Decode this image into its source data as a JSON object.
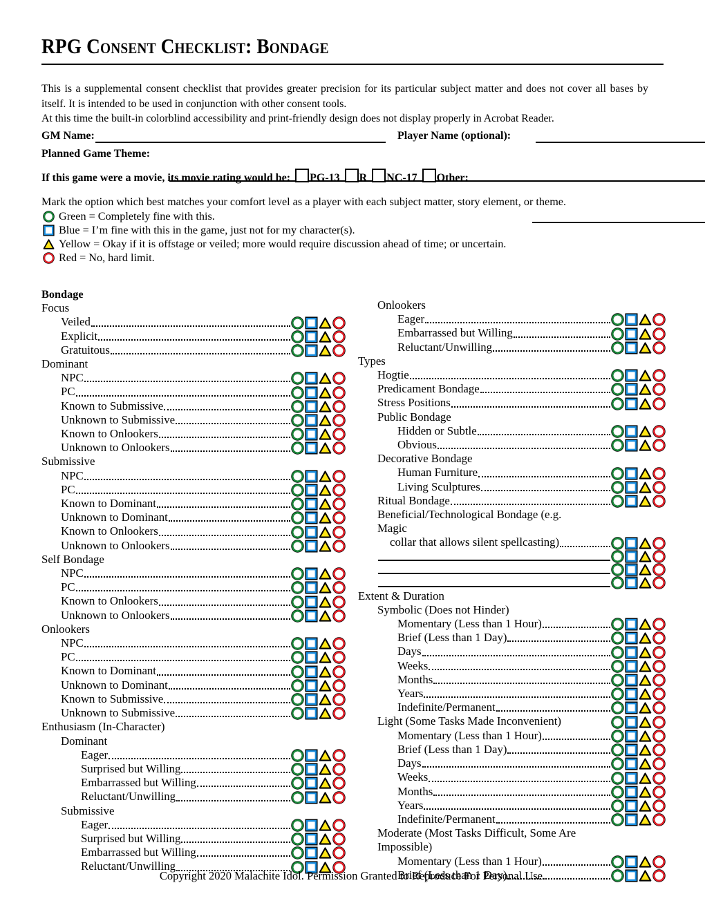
{
  "document": {
    "title": "RPG Consent Checklist: Bondage",
    "intro_line1": "This is a supplemental consent checklist that provides greater precision for its particular subject matter and does not cover all bases by itself. It is intended to be used in conjunction with other consent tools.",
    "intro_line2": "At this time the built-in colorblind accessibility and print-friendly design does not display properly in Acrobat Reader.",
    "footer": "Copyright 2020 Malachite Idol. Permission Granted to Reproduce For Personal Use."
  },
  "form": {
    "gm_name_label": "GM Name:",
    "gm_name_value": "",
    "player_name_label": "Player Name (optional):",
    "player_name_value": "",
    "theme_label": "Planned Game Theme:",
    "theme_value": "",
    "rating_label": "If this game were a movie, its movie rating would be:",
    "ratings": [
      "PG-13",
      "R",
      "NC-17"
    ],
    "other_label": "Other:",
    "other_value": ""
  },
  "legend": {
    "instruction": "Mark the option which best matches your comfort level as a player with each subject matter, story element, or theme.",
    "entries": [
      {
        "icon": "green-circle-icon",
        "text": "Green = Completely fine with this."
      },
      {
        "icon": "blue-square-icon",
        "text": "Blue = I’m fine with this in the game, just not for my character(s)."
      },
      {
        "icon": "yellow-triangle-icon",
        "text": "Yellow = Okay if it is offstage or veiled; more would require discussion ahead of time; or uncertain."
      },
      {
        "icon": "red-circle-icon",
        "text": "Red = No, hard limit."
      }
    ]
  },
  "colors": {
    "green": "#1a8a3a",
    "blue": "#1b8fe0",
    "yellow": "#ffe515",
    "red": "#e8212a",
    "outline": "#000000"
  },
  "section": {
    "name": "Bondage"
  },
  "left_column": [
    {
      "type": "group",
      "label": "Focus",
      "indent": 1
    },
    {
      "type": "item",
      "label": "Veiled",
      "indent": 2
    },
    {
      "type": "item",
      "label": "Explicit",
      "indent": 2
    },
    {
      "type": "item",
      "label": "Gratuitous",
      "indent": 2
    },
    {
      "type": "group",
      "label": "Dominant",
      "indent": 1
    },
    {
      "type": "item",
      "label": "NPC",
      "indent": 2
    },
    {
      "type": "item",
      "label": "PC",
      "indent": 2
    },
    {
      "type": "item",
      "label": "Known to Submissive",
      "indent": 2
    },
    {
      "type": "item",
      "label": "Unknown to Submissive",
      "indent": 2
    },
    {
      "type": "item",
      "label": "Known to Onlookers",
      "indent": 2
    },
    {
      "type": "item",
      "label": "Unknown to Onlookers",
      "indent": 2
    },
    {
      "type": "group",
      "label": "Submissive",
      "indent": 1
    },
    {
      "type": "item",
      "label": "NPC",
      "indent": 2
    },
    {
      "type": "item",
      "label": "PC",
      "indent": 2
    },
    {
      "type": "item",
      "label": "Known to Dominant",
      "indent": 2
    },
    {
      "type": "item",
      "label": "Unknown to Dominant",
      "indent": 2
    },
    {
      "type": "item",
      "label": "Known to Onlookers",
      "indent": 2
    },
    {
      "type": "item",
      "label": "Unknown to Onlookers",
      "indent": 2
    },
    {
      "type": "group",
      "label": "Self Bondage",
      "indent": 1
    },
    {
      "type": "item",
      "label": "NPC",
      "indent": 2
    },
    {
      "type": "item",
      "label": "PC",
      "indent": 2
    },
    {
      "type": "item",
      "label": "Known to Onlookers",
      "indent": 2
    },
    {
      "type": "item",
      "label": "Unknown to Onlookers",
      "indent": 2
    },
    {
      "type": "group",
      "label": "Onlookers",
      "indent": 1
    },
    {
      "type": "item",
      "label": "NPC",
      "indent": 2
    },
    {
      "type": "item",
      "label": "PC",
      "indent": 2
    },
    {
      "type": "item",
      "label": "Known to Dominant",
      "indent": 2
    },
    {
      "type": "item",
      "label": "Unknown to Dominant",
      "indent": 2
    },
    {
      "type": "item",
      "label": "Known to Submissive",
      "indent": 2
    },
    {
      "type": "item",
      "label": "Unknown to Submissive",
      "indent": 2
    },
    {
      "type": "group",
      "label": "Enthusiasm (In-Character)",
      "indent": 1
    },
    {
      "type": "group",
      "label": "Dominant",
      "indent": 2
    },
    {
      "type": "item",
      "label": "Eager",
      "indent": 3
    },
    {
      "type": "item",
      "label": "Surprised but Willing",
      "indent": 3
    },
    {
      "type": "item",
      "label": "Embarrassed but Willing",
      "indent": 3
    },
    {
      "type": "item",
      "label": "Reluctant/Unwilling",
      "indent": 3
    },
    {
      "type": "group",
      "label": "Submissive",
      "indent": 2
    },
    {
      "type": "item",
      "label": "Eager",
      "indent": 3
    },
    {
      "type": "item",
      "label": "Surprised but Willing",
      "indent": 3
    },
    {
      "type": "item",
      "label": "Embarrassed but Willing",
      "indent": 3
    },
    {
      "type": "item",
      "label": "Reluctant/Unwilling",
      "indent": 3
    }
  ],
  "right_column": [
    {
      "type": "group",
      "label": "Onlookers",
      "indent": 2
    },
    {
      "type": "item",
      "label": "Eager",
      "indent": 3
    },
    {
      "type": "item",
      "label": "Embarrassed but Willing",
      "indent": 3
    },
    {
      "type": "item",
      "label": "Reluctant/Unwilling",
      "indent": 3
    },
    {
      "type": "group",
      "label": "Types",
      "indent": 1
    },
    {
      "type": "item",
      "label": "Hogtie",
      "indent": 2
    },
    {
      "type": "item",
      "label": "Predicament Bondage",
      "indent": 2
    },
    {
      "type": "item",
      "label": "Stress Positions",
      "indent": 2
    },
    {
      "type": "group",
      "label": "Public Bondage",
      "indent": 2
    },
    {
      "type": "item",
      "label": "Hidden or Subtle",
      "indent": 3
    },
    {
      "type": "item",
      "label": "Obvious",
      "indent": 3
    },
    {
      "type": "group",
      "label": "Decorative Bondage",
      "indent": 2
    },
    {
      "type": "item",
      "label": "Human Furniture",
      "indent": 3
    },
    {
      "type": "item",
      "label": "Living Sculptures",
      "indent": 3
    },
    {
      "type": "item",
      "label": "Ritual Bondage",
      "indent": 2
    },
    {
      "type": "item_wrap",
      "label": "Beneficial/Technological Bondage (e.g. Magic collar that allows silent spellcasting)",
      "indent": 2
    },
    {
      "type": "blank",
      "label": "",
      "indent": 2
    },
    {
      "type": "blank",
      "label": "",
      "indent": 2
    },
    {
      "type": "blank",
      "label": "",
      "indent": 2
    },
    {
      "type": "group",
      "label": "Extent & Duration",
      "indent": 1
    },
    {
      "type": "group",
      "label": "Symbolic (Does not Hinder)",
      "indent": 2
    },
    {
      "type": "item",
      "label": "Momentary (Less than 1 Hour)",
      "indent": 3
    },
    {
      "type": "item",
      "label": "Brief (Less than 1 Day)",
      "indent": 3
    },
    {
      "type": "item",
      "label": "Days",
      "indent": 3
    },
    {
      "type": "item",
      "label": "Weeks",
      "indent": 3
    },
    {
      "type": "item",
      "label": "Months",
      "indent": 3
    },
    {
      "type": "item",
      "label": "Years",
      "indent": 3
    },
    {
      "type": "item",
      "label": "Indefinite/Permanent",
      "indent": 3
    },
    {
      "type": "group_sym",
      "label": "Light (Some Tasks Made Inconvenient)",
      "indent": 2
    },
    {
      "type": "item",
      "label": "Momentary (Less than 1 Hour)",
      "indent": 3
    },
    {
      "type": "item",
      "label": "Brief (Less than 1 Day)",
      "indent": 3
    },
    {
      "type": "item",
      "label": "Days",
      "indent": 3
    },
    {
      "type": "item",
      "label": "Weeks",
      "indent": 3
    },
    {
      "type": "item",
      "label": "Months",
      "indent": 3
    },
    {
      "type": "item",
      "label": "Years",
      "indent": 3
    },
    {
      "type": "item",
      "label": "Indefinite/Permanent",
      "indent": 3
    },
    {
      "type": "group_wrap",
      "label": "Moderate (Most Tasks Difficult, Some Are Impossible)",
      "indent": 2
    },
    {
      "type": "item",
      "label": "Momentary (Less than 1 Hour)",
      "indent": 3
    },
    {
      "type": "item",
      "label": "Brief (Less than 1 Day)",
      "indent": 3
    }
  ]
}
